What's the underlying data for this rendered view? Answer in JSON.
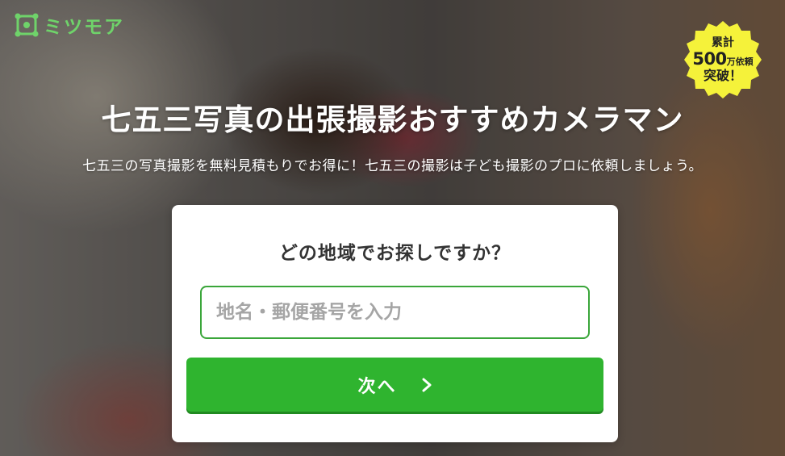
{
  "logo": {
    "text": "ミツモア"
  },
  "badge": {
    "line1": "累計",
    "number": "500",
    "unit": "万依頼",
    "line3": "突破！"
  },
  "hero": {
    "title": "七五三写真の出張撮影おすすめカメラマン",
    "subtitle": "七五三の写真撮影を無料見積もりでお得に！七五三の撮影は子ども撮影のプロに依頼しましょう。"
  },
  "search_card": {
    "question": "どの地域でお探しですか？",
    "input": {
      "placeholder": "地名・郵便番号を入力",
      "value": ""
    },
    "next_label": "次へ",
    "next_icon": "chevron-right-icon"
  },
  "colors": {
    "brand_green": "#2fb42f",
    "logo_green": "#6fd36a",
    "badge_yellow": "#f5f23a",
    "input_border": "#3aa63a"
  }
}
